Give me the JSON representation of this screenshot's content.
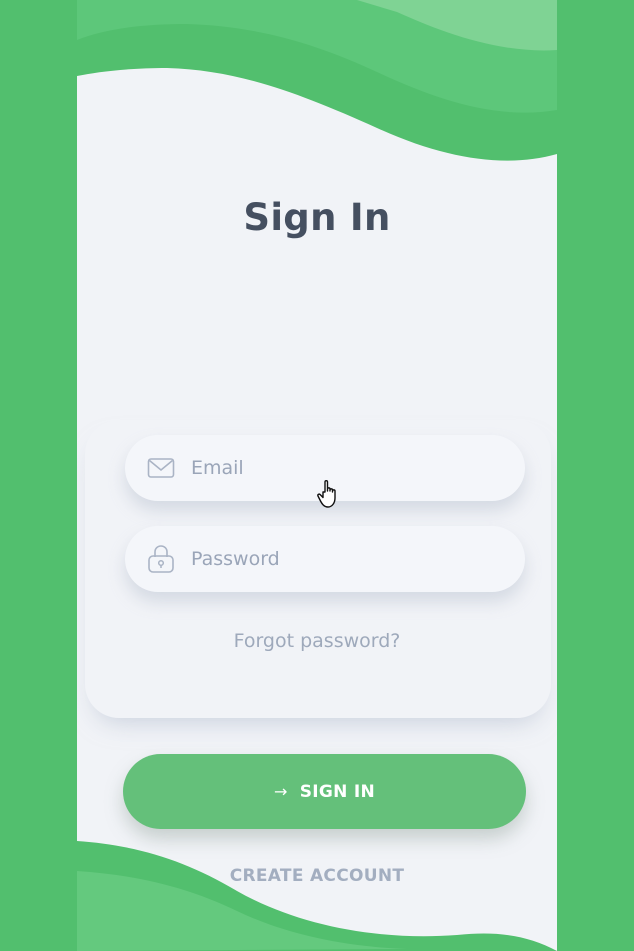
{
  "screen": {
    "title": "Sign In"
  },
  "email": {
    "placeholder": "Email",
    "value": "",
    "icon": "mail-icon"
  },
  "password": {
    "placeholder": "Password",
    "value": "",
    "icon": "lock-icon"
  },
  "links": {
    "forgot_password": "Forgot password?",
    "create_account": "CREATE ACCOUNT"
  },
  "signin_button": {
    "arrow": "→",
    "label": "SIGN IN"
  },
  "colors": {
    "brand_green": "#52bf6e",
    "button_green": "#64c07a",
    "background": "#f1f3f7",
    "title_text": "#454f60",
    "muted_text": "#9ea9bb"
  }
}
